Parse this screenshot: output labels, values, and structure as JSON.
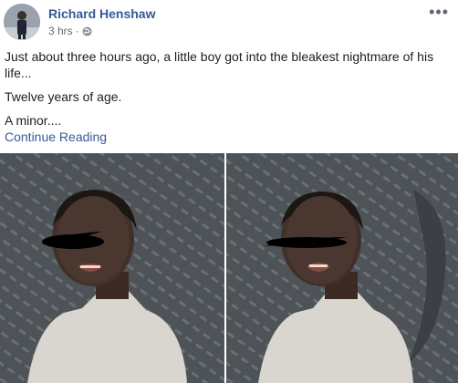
{
  "post": {
    "author": "Richard Henshaw",
    "time": "3 hrs",
    "privacy_icon": "globe-icon",
    "more_icon": "more-options-icon",
    "paragraphs": [
      "Just about three hours ago, a little boy got into the bleakest nightmare of his life...",
      "Twelve years of age.",
      "A minor...."
    ],
    "continue_label": "Continue Reading"
  },
  "photos": [
    {
      "description_icon": "photo"
    },
    {
      "description_icon": "photo"
    }
  ],
  "colors": {
    "link": "#385898",
    "meta": "#616770",
    "text": "#1c1e21"
  }
}
